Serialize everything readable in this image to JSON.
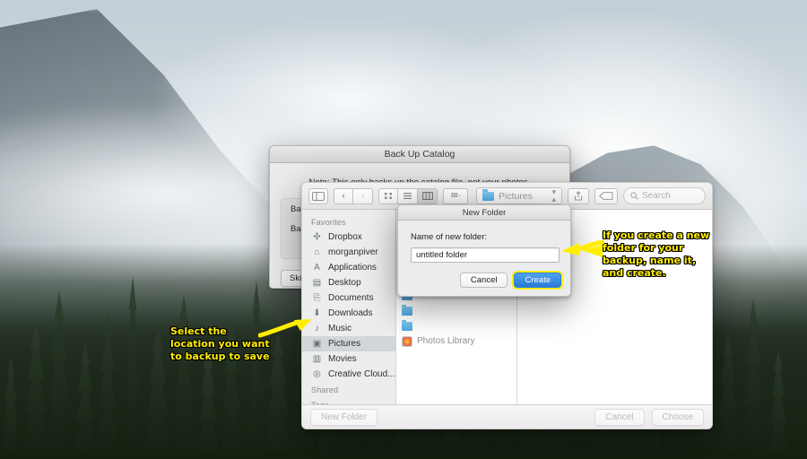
{
  "desktop": {
    "wallpaper_name": "yosemite-half-dome-fog"
  },
  "backup_dialog": {
    "title": "Back Up Catalog",
    "note": "Note: This only backs up the catalog file, not your photos.",
    "row1_label": "Back u",
    "row2_label": "Backu",
    "skip_button": "Skip u"
  },
  "finder": {
    "toolbar": {
      "sidebar_toggle_icon": "sidebar-toggle-icon",
      "back_icon": "‹",
      "forward_icon": "›",
      "view_icon_grid": "∷",
      "view_icon_list": "≡",
      "view_icon_column": "Ⅽ",
      "arrange_icon": "∷",
      "arrange_caret": "⌄",
      "path_value": "Pictures",
      "path_folder_icon": "folder-icon",
      "stepper_icon": "⌃⌄",
      "share_icon": "⇧",
      "tag_icon": "▭",
      "search_icon": "⌕",
      "search_placeholder": "Search"
    },
    "sidebar": {
      "sections": [
        {
          "heading": "Favorites",
          "items": [
            {
              "label": "Dropbox",
              "icon": "dropbox-icon",
              "glyph": "✣",
              "selected": false
            },
            {
              "label": "morganpiver",
              "icon": "home-icon",
              "glyph": "⌂",
              "selected": false
            },
            {
              "label": "Applications",
              "icon": "applications-icon",
              "glyph": "A",
              "selected": false
            },
            {
              "label": "Desktop",
              "icon": "desktop-icon",
              "glyph": "▤",
              "selected": false
            },
            {
              "label": "Documents",
              "icon": "documents-icon",
              "glyph": "⎘",
              "selected": false
            },
            {
              "label": "Downloads",
              "icon": "downloads-icon",
              "glyph": "⬇",
              "selected": false
            },
            {
              "label": "Music",
              "icon": "music-icon",
              "glyph": "♪",
              "selected": false
            },
            {
              "label": "Pictures",
              "icon": "pictures-icon",
              "glyph": "▣",
              "selected": true
            },
            {
              "label": "Movies",
              "icon": "movies-icon",
              "glyph": "▥",
              "selected": false
            },
            {
              "label": "Creative Cloud...",
              "icon": "creative-cloud-icon",
              "glyph": "◎",
              "selected": false
            }
          ]
        },
        {
          "heading": "Shared",
          "items": []
        },
        {
          "heading": "Tags",
          "items": []
        }
      ]
    },
    "file_list": {
      "items": [
        {
          "label": "",
          "icon": "blue-folder-icon"
        },
        {
          "label": "",
          "icon": "blue-folder-icon"
        },
        {
          "label": "",
          "icon": "blue-folder-icon"
        },
        {
          "label": "",
          "icon": "blue-folder-icon"
        },
        {
          "label": "",
          "icon": "blue-folder-icon"
        },
        {
          "label": "",
          "icon": "blue-folder-icon"
        },
        {
          "label": "",
          "icon": "blue-folder-icon"
        },
        {
          "label": "",
          "icon": "blue-folder-icon"
        },
        {
          "label": "Photos Library",
          "icon": "photos-library-icon"
        }
      ]
    },
    "bottom_bar": {
      "new_folder_button": "New Folder",
      "cancel_button": "Cancel",
      "choose_button": "Choose"
    }
  },
  "new_folder_dialog": {
    "title": "New Folder",
    "field_label": "Name of new folder:",
    "field_value": "untitled folder",
    "cancel_button": "Cancel",
    "create_button": "Create",
    "highlight_color": "#ffed00",
    "accent_color": "#2a7ad6"
  },
  "annotations": {
    "left_text": "Select the\nlocation you want\nto backup to save",
    "right_text": "If you create a new\nfolder for your\nbackup, name it,\nand create.",
    "color": "#ffee00",
    "left_arrow_icon": "arrow-right-icon",
    "right_arrow_icon": "arrow-left-icon",
    "mid_arrow_icon": "arrow-left-icon"
  }
}
